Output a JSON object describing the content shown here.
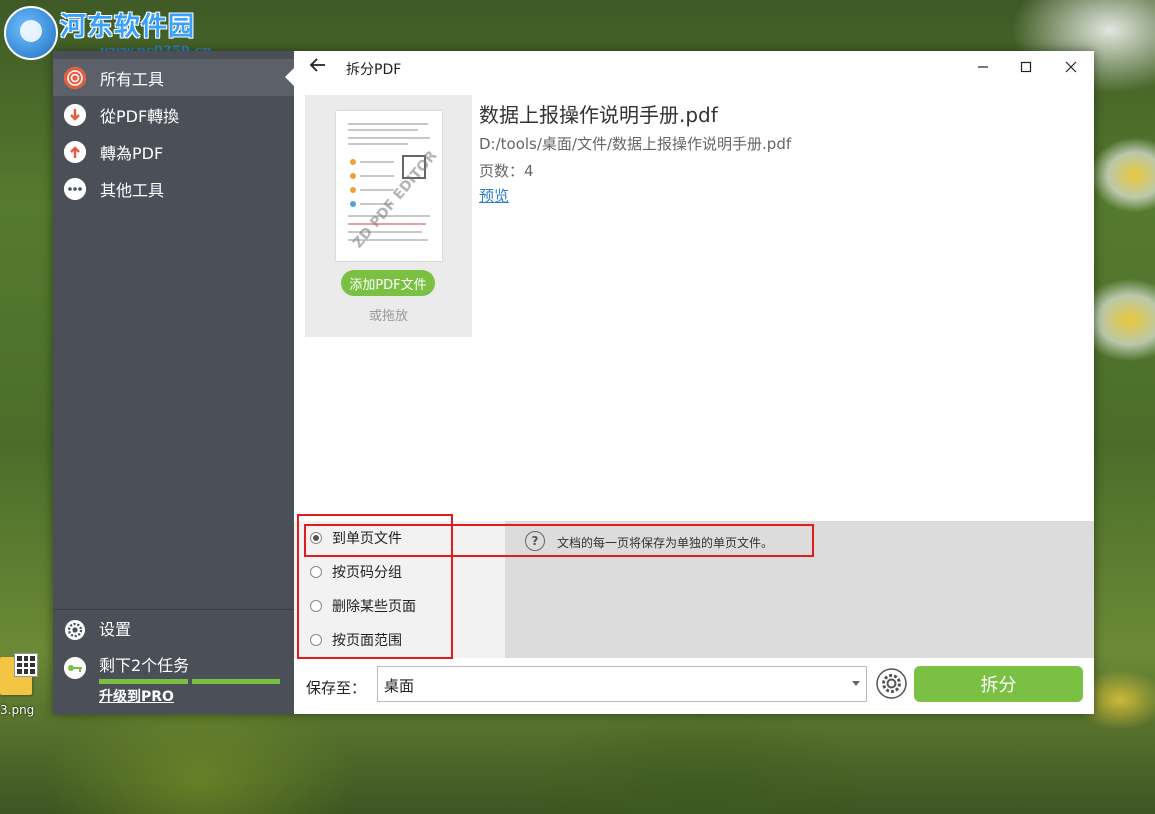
{
  "watermark": {
    "site_name": "河东软件园",
    "url": "www.pc0359.cn"
  },
  "desktop": {
    "file_label": "3.png"
  },
  "sidebar": {
    "items": [
      {
        "label": "所有工具",
        "icon": "target-icon"
      },
      {
        "label": "從PDF轉換",
        "icon": "arrow-down-icon"
      },
      {
        "label": "轉為PDF",
        "icon": "arrow-up-icon"
      },
      {
        "label": "其他工具",
        "icon": "more-dots-icon"
      }
    ],
    "settings_label": "设置",
    "tasks_label": "剩下2个任务",
    "upgrade_label": "升级到PRO"
  },
  "window": {
    "title": "拆分PDF"
  },
  "file": {
    "add_button": "添加PDF文件",
    "drag_hint": "或拖放",
    "thumbnail_stamp": "ZD PDF EDITOR",
    "name": "数据上报操作说明手册.pdf",
    "path": "D:/tools/桌面/文件/数据上报操作说明手册.pdf",
    "pages": "页数：4",
    "preview_link": "预览"
  },
  "split_options": [
    {
      "label": "到单页文件",
      "checked": true
    },
    {
      "label": "按页码分组",
      "checked": false
    },
    {
      "label": "删除某些页面",
      "checked": false
    },
    {
      "label": "按页面范围",
      "checked": false
    }
  ],
  "help_text": "文档的每一页将保存为单独的单页文件。",
  "save": {
    "label": "保存至：",
    "value": "桌面"
  },
  "split_button": "拆分",
  "colors": {
    "sidebar_bg": "#4a4f58",
    "accent_green": "#7ac143",
    "link_blue": "#2b7ed1",
    "highlight_red": "#e21b1b"
  }
}
